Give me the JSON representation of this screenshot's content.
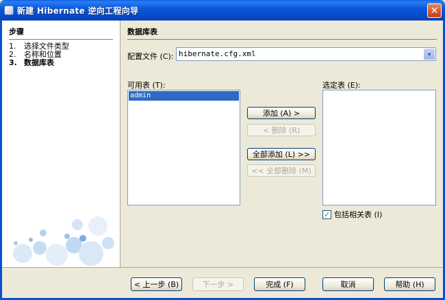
{
  "window": {
    "title": "新建 Hibernate 逆向工程向导",
    "close_glyph": "✕"
  },
  "steps": {
    "title": "步骤",
    "items": [
      {
        "num": "1.",
        "label": "选择文件类型"
      },
      {
        "num": "2.",
        "label": "名称和位置"
      },
      {
        "num": "3.",
        "label": "数据库表"
      }
    ]
  },
  "main": {
    "section_title": "数据库表",
    "config_label": "配置文件 (C):",
    "config_value": "hibernate.cfg.xml",
    "available_label": "可用表 (T):",
    "selected_label": "选定表 (E):",
    "available_tables": [
      "admin"
    ],
    "add_button": "添加 (A) >",
    "remove_button": "< 删除 (R)",
    "add_all_button": "全部添加 (L) >>",
    "remove_all_button": "<< 全部删除 (M)",
    "include_related_label": "包括相关表 (I)",
    "include_related_checked": true
  },
  "footer": {
    "back": "< 上一步 (B)",
    "next": "下一步 >",
    "finish": "完成 (F)",
    "cancel": "取消",
    "help": "帮助 (H)"
  },
  "icons": {
    "app": "app-cube-icon",
    "close": "close-icon",
    "combo_arrow": "chevron-down-icon",
    "checkmark": "checkmark-icon"
  },
  "colors": {
    "titlebar": "#0b5ad8",
    "selection": "#316ac5",
    "dialog_bg": "#ece9d8",
    "close_button": "#c23b14"
  }
}
